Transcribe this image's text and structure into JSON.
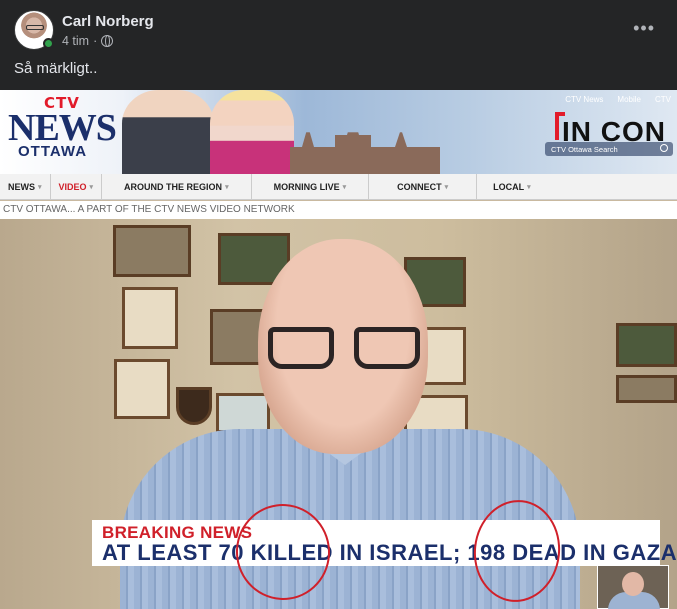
{
  "post": {
    "author": "Carl Norberg",
    "time": "4 tim",
    "separator": "·",
    "text": "Så märkligt..",
    "more": "•••"
  },
  "screenshot": {
    "logo_top": "CTV",
    "logo_news": "NEWS",
    "logo_city": "OTTAWA",
    "top_links": [
      "CTV News",
      "Mobile",
      "CTV"
    ],
    "promo": "IN CON",
    "search_placeholder": "CTV Ottawa Search",
    "nav": [
      {
        "label": "NEWS",
        "active": false
      },
      {
        "label": "VIDEO",
        "active": true
      },
      {
        "label": "AROUND THE REGION",
        "active": false
      },
      {
        "label": "MORNING LIVE",
        "active": false
      },
      {
        "label": "CONNECT",
        "active": false
      },
      {
        "label": "LOCAL",
        "active": false
      }
    ],
    "strip": "CTV OTTAWA... A PART OF THE CTV NEWS VIDEO NETWORK",
    "breaking_label": "BREAKING NEWS",
    "headline": "AT LEAST 70 KILLED IN ISRAEL; 198 DEAD IN GAZA"
  },
  "colors": {
    "bg": "#242526",
    "text": "#e4e6eb",
    "muted": "#b0b3b8",
    "ctv_red": "#d0202a",
    "ctv_navy": "#1b2f6b"
  }
}
